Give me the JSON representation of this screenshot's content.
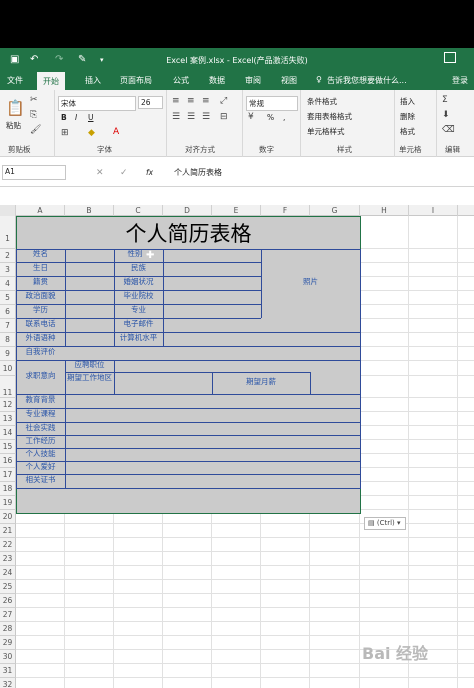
{
  "window": {
    "title": "Excel 案例.xlsx - Excel(产品激活失败)",
    "login": "登录"
  },
  "menu": {
    "tabs": [
      "文件",
      "开始",
      "插入",
      "页面布局",
      "公式",
      "数据",
      "审阅",
      "视图"
    ],
    "active": "开始",
    "tell_me": "告诉我您想要做什么..."
  },
  "ribbon": {
    "clipboard": {
      "label": "剪贴板",
      "paste": "粘贴"
    },
    "font": {
      "label": "字体",
      "name": "宋体",
      "size": "26",
      "bold": "B",
      "italic": "I",
      "underline": "U"
    },
    "alignment": {
      "label": "对齐方式"
    },
    "number": {
      "label": "数字",
      "format": "常规",
      "pct": "%",
      "comma": ","
    },
    "styles": {
      "label": "样式",
      "cond": "条件格式",
      "table": "套用表格格式",
      "cell": "单元格样式"
    },
    "cells": {
      "label": "单元格",
      "insert": "插入",
      "delete": "删除",
      "format": "格式"
    },
    "editing": {
      "label": "编辑"
    }
  },
  "formula_bar": {
    "name_box": "A1",
    "fx": "fx",
    "content": "个人简历表格"
  },
  "columns": [
    "A",
    "B",
    "C",
    "D",
    "E",
    "F",
    "G",
    "H",
    "I"
  ],
  "rows": [
    "1",
    "2",
    "3",
    "4",
    "5",
    "6",
    "7",
    "8",
    "9",
    "10",
    "11",
    "12",
    "13",
    "14",
    "15",
    "16",
    "17",
    "18",
    "19",
    "20",
    "21",
    "22",
    "23",
    "24",
    "25",
    "26",
    "27",
    "28",
    "29",
    "30",
    "31",
    "32",
    "33"
  ],
  "resume": {
    "title": "个人简历表格",
    "name": "姓名",
    "gender": "性别",
    "birth": "生日",
    "nation": "民族",
    "native": "籍贯",
    "marital": "婚姻状况",
    "politics": "政治面貌",
    "school": "毕业院校",
    "education": "学历",
    "major": "专业",
    "phone": "联系电话",
    "email": "电子邮件",
    "foreign": "外语语种",
    "computer": "计算机水平",
    "self_eval": "自我评价",
    "job_intent": "求职意向",
    "position": "应聘职位",
    "location": "期望工作地区",
    "salary": "期望月薪",
    "edu_bg": "教育背景",
    "courses": "专业课程",
    "practice": "社会实践",
    "work": "工作经历",
    "skills": "个人技能",
    "hobbies": "个人爱好",
    "certs": "相关证书",
    "photo": "照片"
  },
  "paste_tag": "(Ctrl)",
  "watermark": "Bai 经验"
}
